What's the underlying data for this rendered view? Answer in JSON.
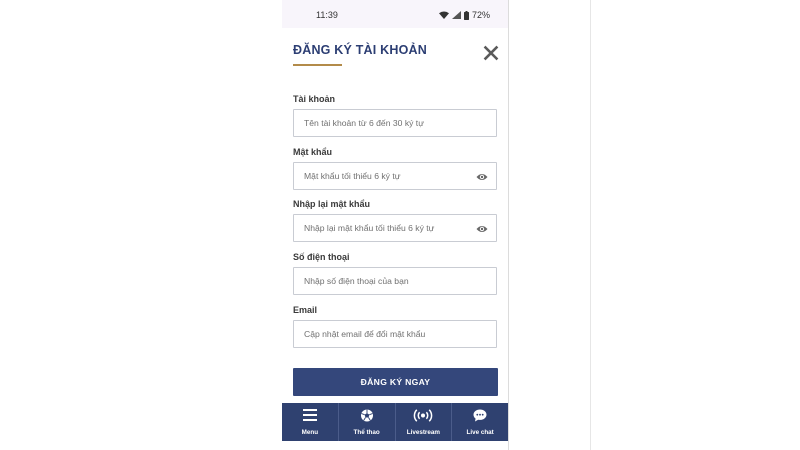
{
  "status_bar": {
    "time": "11:39",
    "battery": "72%"
  },
  "form": {
    "title": "ĐĂNG KÝ TÀI KHOẢN",
    "fields": [
      {
        "label": "Tài khoản",
        "placeholder": "Tên tài khoản từ 6 đến 30 ký tự",
        "value": ""
      },
      {
        "label": "Mật khẩu",
        "placeholder": "Mật khẩu tối thiểu 6 ký tự",
        "value": ""
      },
      {
        "label": "Nhập lại mật khẩu",
        "placeholder": "Nhập lại mật khẩu tối thiểu 6 ký tự",
        "value": ""
      },
      {
        "label": "Số điện thoại",
        "placeholder": "Nhập số điện thoại của bạn",
        "value": ""
      },
      {
        "label": "Email",
        "placeholder": "Cập nhật email để đổi mật khẩu",
        "value": ""
      }
    ],
    "submit_label": "ĐĂNG KÝ NGAY"
  },
  "bottom_nav": {
    "items": [
      {
        "label": "Menu",
        "icon": "menu-icon"
      },
      {
        "label": "Thể thao",
        "icon": "soccer-ball-icon"
      },
      {
        "label": "Livestream",
        "icon": "broadcast-icon"
      },
      {
        "label": "Live chat",
        "icon": "chat-bubble-icon"
      }
    ]
  },
  "colors": {
    "primary": "#34477b",
    "title": "#2c3e73",
    "accent_underline": "#b38b4a",
    "nav_background": "#2f4170"
  }
}
